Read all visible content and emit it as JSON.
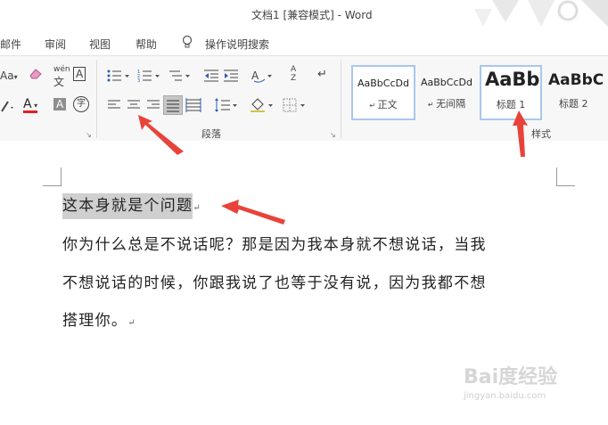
{
  "window": {
    "title": "文档1 [兼容模式]  -  Word"
  },
  "menu": {
    "items": [
      "邮件",
      "审阅",
      "视图",
      "帮助"
    ],
    "tell_me_label": "操作说明搜索"
  },
  "ribbon": {
    "font_group": {
      "aa_label": "Aa",
      "font_color_letter": "A",
      "wen_label": "wén",
      "wen_char": "文",
      "char_border": "A",
      "shade_letter": "A",
      "enclose_char": "字"
    },
    "paragraph_group": {
      "label": "段落",
      "sort_label": "A Z"
    },
    "styles_group": {
      "label": "样式",
      "styles": [
        {
          "sample": "AaBbCcDd",
          "name": "正文"
        },
        {
          "sample": "AaBbCcDd",
          "name": "无间隔"
        },
        {
          "sample": "AaBb",
          "name": "标题 1"
        },
        {
          "sample": "AaBbC",
          "name": "标题 2"
        }
      ]
    }
  },
  "document": {
    "lines": [
      "这本身就是个问题",
      "你为什么总是不说话呢？那是因为我本身就不想说话，当我",
      "不想说话的时候，你跟我说了也等于没有说，因为我都不想",
      "搭理你。"
    ],
    "paragraph_mark": "↵"
  },
  "watermark": {
    "main": "Bai度经验",
    "sub": "jingyan.baidu.com"
  },
  "colors": {
    "arrow": "#e8433a",
    "selected_style_border": "#a9c7ec",
    "highlight": "#cfcfcf",
    "font_color_underline": "#e02020"
  }
}
